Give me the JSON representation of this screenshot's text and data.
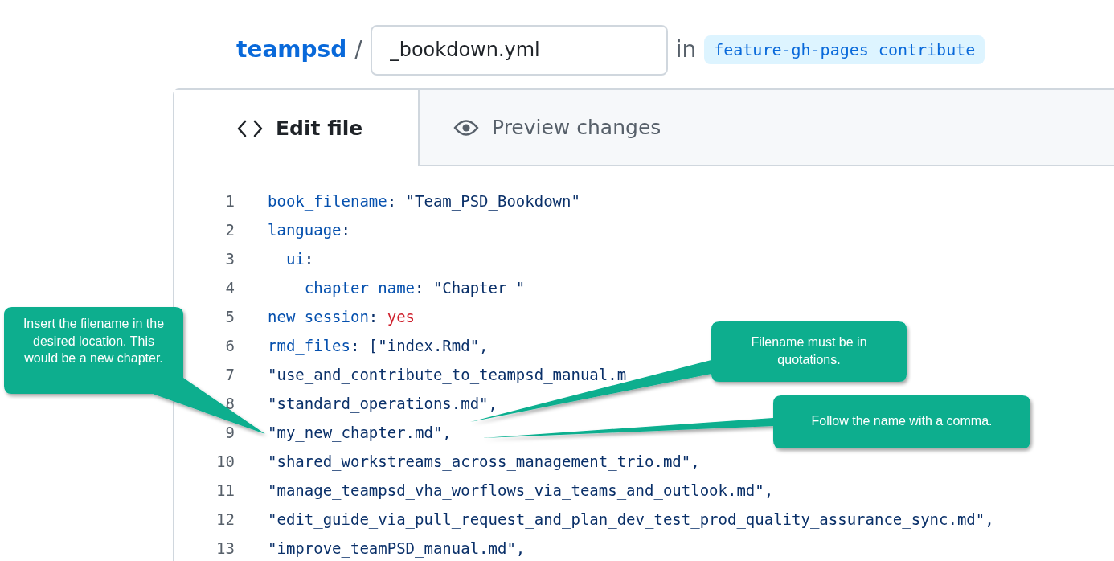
{
  "breadcrumb": {
    "repo": "teampsd",
    "separator": "/",
    "filename": "_bookdown.yml",
    "in_label": "in",
    "branch": "feature-gh-pages_contribute"
  },
  "tabs": [
    {
      "label": "Edit file",
      "selected": true
    },
    {
      "label": "Preview changes",
      "selected": false
    }
  ],
  "code_lines": [
    {
      "number": "1",
      "tokens": [
        {
          "kind": "key",
          "text": "book_filename"
        },
        {
          "kind": "text",
          "text": ": \"Team_PSD_Bookdown\""
        }
      ]
    },
    {
      "number": "2",
      "tokens": [
        {
          "kind": "key",
          "text": "language"
        },
        {
          "kind": "text",
          "text": ":"
        }
      ]
    },
    {
      "number": "3",
      "tokens": [
        {
          "kind": "key",
          "text": "  ui"
        },
        {
          "kind": "text",
          "text": ":"
        }
      ]
    },
    {
      "number": "4",
      "tokens": [
        {
          "kind": "key",
          "text": "    chapter_name"
        },
        {
          "kind": "text",
          "text": ": \"Chapter \""
        }
      ]
    },
    {
      "number": "5",
      "tokens": [
        {
          "kind": "key",
          "text": "new_session"
        },
        {
          "kind": "text",
          "text": ": "
        },
        {
          "kind": "bool",
          "text": "yes"
        }
      ]
    },
    {
      "number": "6",
      "tokens": [
        {
          "kind": "key",
          "text": "rmd_files"
        },
        {
          "kind": "text",
          "text": ": [\"index.Rmd\","
        }
      ]
    },
    {
      "number": "7",
      "tokens": [
        {
          "kind": "text",
          "text": "\"use_and_contribute_to_teampsd_manual.m"
        }
      ]
    },
    {
      "number": "8",
      "tokens": [
        {
          "kind": "text",
          "text": "\"standard_operations.md\","
        }
      ]
    },
    {
      "number": "9",
      "tokens": [
        {
          "kind": "text",
          "text": "\"my_new_chapter.md\","
        }
      ]
    },
    {
      "number": "10",
      "tokens": [
        {
          "kind": "text",
          "text": "\"shared_workstreams_across_management_trio.md\","
        }
      ]
    },
    {
      "number": "11",
      "tokens": [
        {
          "kind": "text",
          "text": "\"manage_teampsd_vha_worflows_via_teams_and_outlook.md\","
        }
      ]
    },
    {
      "number": "12",
      "tokens": [
        {
          "kind": "text",
          "text": "\"edit_guide_via_pull_request_and_plan_dev_test_prod_quality_assurance_sync.md\","
        }
      ]
    },
    {
      "number": "13",
      "tokens": [
        {
          "kind": "text",
          "text": "\"improve_teamPSD_manual.md\","
        }
      ]
    }
  ],
  "callouts": [
    {
      "text": "Insert the filename in the desired location. This would be a new chapter."
    },
    {
      "text": "Filename must be in quotations."
    },
    {
      "text": "Follow the name with a comma."
    }
  ]
}
